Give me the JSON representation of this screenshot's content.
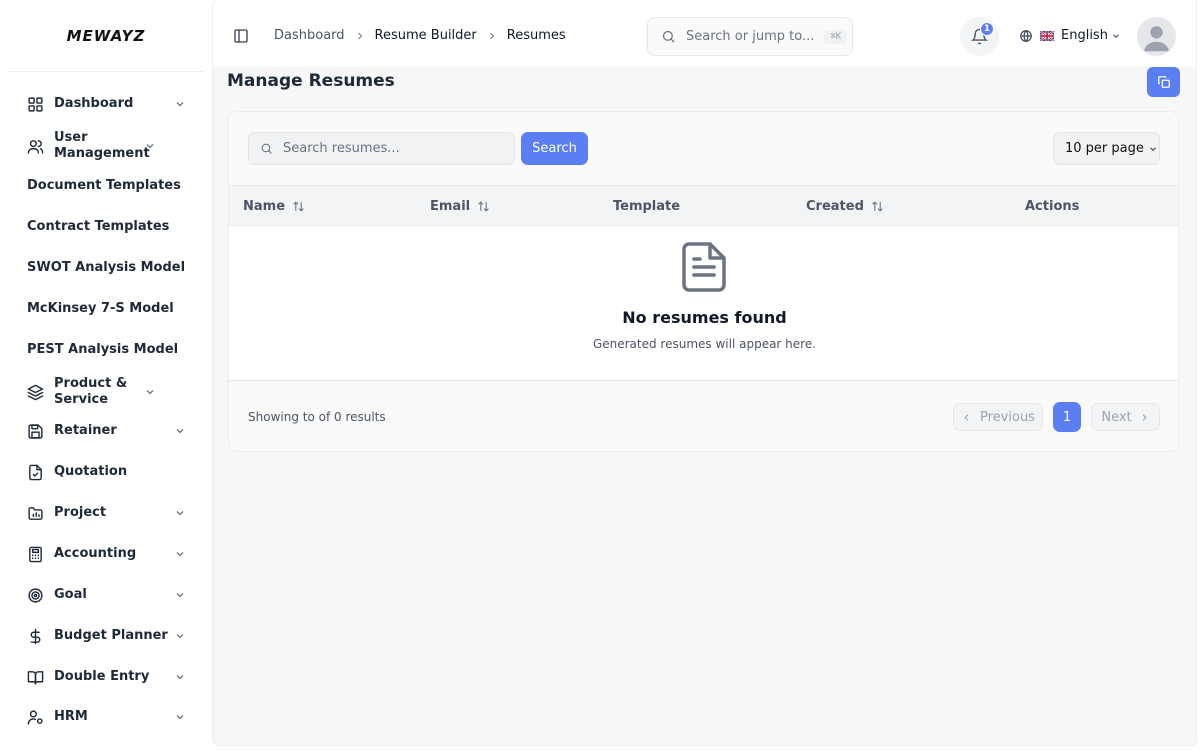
{
  "app": {
    "logo": "MEWAYZ"
  },
  "sidebar": {
    "items": [
      {
        "label": "Dashboard",
        "icon": "grid-icon",
        "chevron": true
      },
      {
        "label": "User Management",
        "icon": "users-icon",
        "chevron": true
      },
      {
        "label": "Document Templates",
        "icon": "",
        "chevron": false
      },
      {
        "label": "Contract Templates",
        "icon": "",
        "chevron": false
      },
      {
        "label": "SWOT Analysis Model",
        "icon": "",
        "chevron": false
      },
      {
        "label": "McKinsey 7-S Model",
        "icon": "",
        "chevron": false
      },
      {
        "label": "PEST Analysis Model",
        "icon": "",
        "chevron": false
      },
      {
        "label": "Product & Service",
        "icon": "layers-icon",
        "chevron": true
      },
      {
        "label": "Retainer",
        "icon": "save-icon",
        "chevron": true
      },
      {
        "label": "Quotation",
        "icon": "file-check-icon",
        "chevron": false
      },
      {
        "label": "Project",
        "icon": "folder-chart-icon",
        "chevron": true
      },
      {
        "label": "Accounting",
        "icon": "calculator-icon",
        "chevron": true
      },
      {
        "label": "Goal",
        "icon": "target-icon",
        "chevron": true
      },
      {
        "label": "Budget Planner",
        "icon": "dollar-icon",
        "chevron": true
      },
      {
        "label": "Double Entry",
        "icon": "book-icon",
        "chevron": true
      },
      {
        "label": "HRM",
        "icon": "user-cog-icon",
        "chevron": true
      }
    ]
  },
  "header": {
    "breadcrumb": [
      "Dashboard",
      "Resume Builder",
      "Resumes"
    ],
    "search_placeholder": "Search or jump to...",
    "search_shortcut": "⌘K",
    "notification_count": "1",
    "language": "English"
  },
  "page": {
    "title": "Manage Resumes",
    "search_placeholder": "Search resumes...",
    "search_button": "Search",
    "per_page": "10 per page",
    "columns": [
      {
        "label": "Name",
        "sortable": true
      },
      {
        "label": "Email",
        "sortable": true
      },
      {
        "label": "Template",
        "sortable": false
      },
      {
        "label": "Created",
        "sortable": true
      },
      {
        "label": "Actions",
        "sortable": false
      }
    ],
    "empty_title": "No resumes found",
    "empty_subtitle": "Generated resumes will appear here.",
    "showing_text": "Showing to of 0 results",
    "pagination": {
      "previous": "Previous",
      "current": "1",
      "next": "Next"
    }
  },
  "colors": {
    "accent": "#5b7ff2",
    "background": "#f7f7f8",
    "text": "#111827"
  }
}
